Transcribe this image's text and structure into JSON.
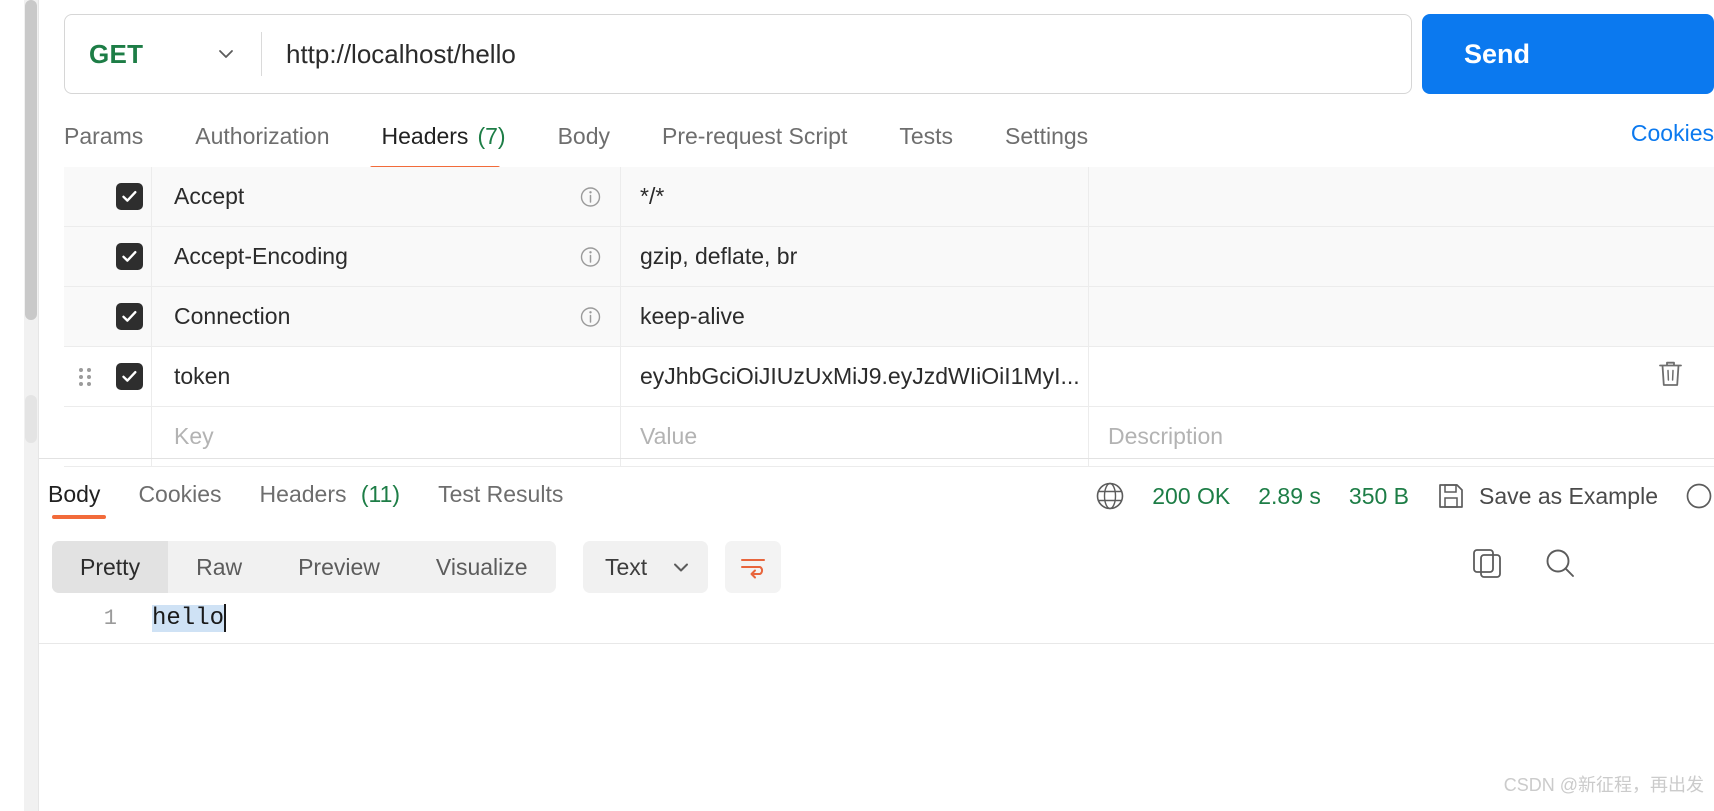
{
  "request": {
    "method": "GET",
    "url": "http://localhost/hello",
    "send_label": "Send",
    "cookies_link": "Cookies",
    "tabs": [
      {
        "label": "Params",
        "count": ""
      },
      {
        "label": "Authorization",
        "count": ""
      },
      {
        "label": "Headers",
        "count": "(7)"
      },
      {
        "label": "Body",
        "count": ""
      },
      {
        "label": "Pre-request Script",
        "count": ""
      },
      {
        "label": "Tests",
        "count": ""
      },
      {
        "label": "Settings",
        "count": ""
      }
    ],
    "active_tab": "Headers"
  },
  "headers_table": {
    "placeholders": {
      "key": "Key",
      "value": "Value",
      "description": "Description"
    },
    "rows": [
      {
        "enabled": true,
        "key": "Accept",
        "value": "*/*",
        "description": "",
        "has_info": true,
        "has_handle": false,
        "has_trash": false
      },
      {
        "enabled": true,
        "key": "Accept-Encoding",
        "value": "gzip, deflate, br",
        "description": "",
        "has_info": true,
        "has_handle": false,
        "has_trash": false
      },
      {
        "enabled": true,
        "key": "Connection",
        "value": "keep-alive",
        "description": "",
        "has_info": true,
        "has_handle": false,
        "has_trash": false
      },
      {
        "enabled": true,
        "key": "token",
        "value": "eyJhbGciOiJIUzUxMiJ9.eyJzdWIiOiI1MyI...",
        "description": "",
        "has_info": false,
        "has_handle": true,
        "has_trash": true
      }
    ]
  },
  "response": {
    "tabs": [
      {
        "label": "Body",
        "count": ""
      },
      {
        "label": "Cookies",
        "count": ""
      },
      {
        "label": "Headers",
        "count": "(11)"
      },
      {
        "label": "Test Results",
        "count": ""
      }
    ],
    "active_tab": "Body",
    "status_code": "200 OK",
    "time": "2.89 s",
    "size": "350 B",
    "save_as_example": "Save as Example",
    "format_tabs": [
      "Pretty",
      "Raw",
      "Preview",
      "Visualize"
    ],
    "active_format": "Pretty",
    "content_type": "Text",
    "line_number": "1",
    "body_text": "hello"
  },
  "colors": {
    "accent_orange": "#f26b3a",
    "send_blue": "#0b79ef",
    "status_green": "#1d7d46",
    "method_green": "#1d7d46",
    "link_blue": "#0b79ef"
  },
  "watermark": "CSDN @新征程，再出发"
}
